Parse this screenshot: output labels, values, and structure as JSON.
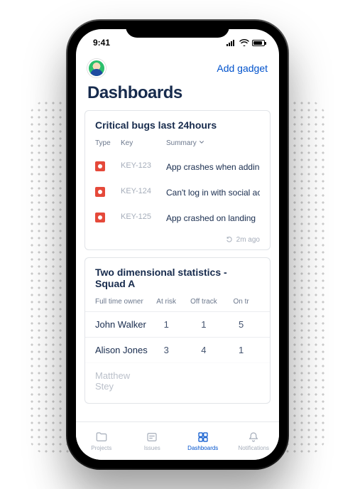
{
  "status": {
    "time": "9:41"
  },
  "header": {
    "add_gadget": "Add gadget"
  },
  "title": "Dashboards",
  "bugs": {
    "title": "Critical bugs last 24hours",
    "cols": {
      "type": "Type",
      "key": "Key",
      "summary": "Summary"
    },
    "rows": [
      {
        "key": "KEY-123",
        "summary": "App crashes when adding attachment"
      },
      {
        "key": "KEY-124",
        "summary": "Can't log in with social accounts"
      },
      {
        "key": "KEY-125",
        "summary": "App crashed on landing"
      }
    ],
    "updated": "2m ago"
  },
  "stats": {
    "title": "Two dimensional statistics - Squad A",
    "cols": {
      "owner": "Full time owner",
      "risk": "At risk",
      "off": "Off track",
      "on": "On tr"
    },
    "rows": [
      {
        "owner": "John Walker",
        "risk": "1",
        "off": "1",
        "on": "5"
      },
      {
        "owner": "Alison Jones",
        "risk": "3",
        "off": "4",
        "on": "1"
      },
      {
        "owner": "Matthew Stey",
        "risk": "",
        "off": "",
        "on": ""
      }
    ]
  },
  "tabs": {
    "projects": "Projects",
    "issues": "Issues",
    "dashboards": "Dashboards",
    "notifications": "Notifications"
  }
}
